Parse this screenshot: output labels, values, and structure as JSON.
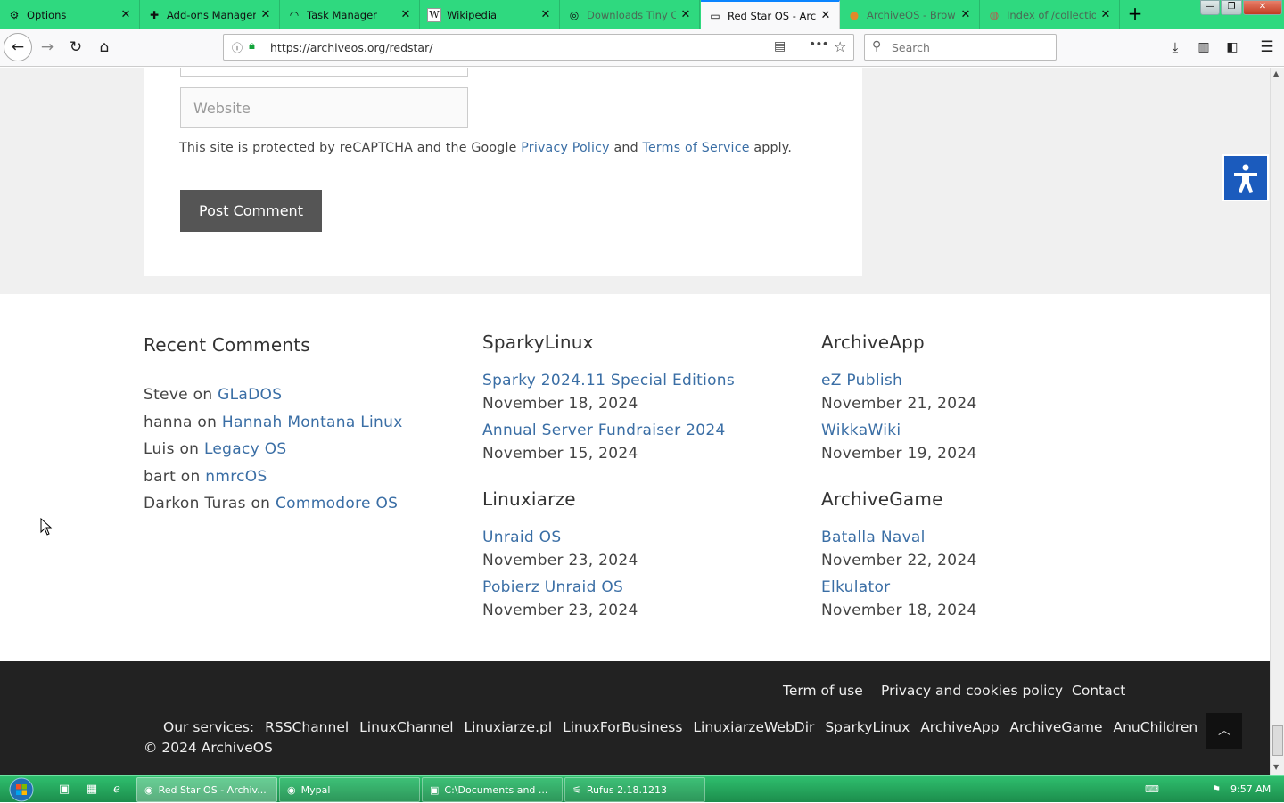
{
  "tabs": [
    {
      "label": "Options",
      "icon": "gear-icon"
    },
    {
      "label": "Add-ons Manager",
      "icon": "puzzle-icon"
    },
    {
      "label": "Task Manager",
      "icon": "gauge-icon"
    },
    {
      "label": "Wikipedia",
      "icon": "wikipedia-icon"
    },
    {
      "label": "Downloads Tiny C",
      "icon": "circle-icon"
    },
    {
      "label": "Red Star OS - Archi",
      "icon": "monitor-icon"
    },
    {
      "label": "ArchiveOS - Brows",
      "icon": "archive-icon"
    },
    {
      "label": "Index of /collectio",
      "icon": "globe-icon"
    }
  ],
  "navbar": {
    "url": "https://archiveos.org/redstar/",
    "search_placeholder": "Search"
  },
  "comment_form": {
    "website_placeholder": "Website",
    "recaptcha_prefix": "This site is protected by reCAPTCHA and the Google",
    "privacy_link": "Privacy Policy",
    "and": "and",
    "terms_link": "Terms of Service",
    "recaptcha_suffix": "apply.",
    "post_button": "Post Comment"
  },
  "recent_comments": {
    "title": "Recent Comments",
    "on": "on",
    "items": [
      {
        "author": "Steve",
        "post": "GLaDOS"
      },
      {
        "author": "hanna",
        "post": "Hannah Montana Linux"
      },
      {
        "author": "Luis",
        "post": "Legacy OS"
      },
      {
        "author": "bart",
        "post": "nmrcOS"
      },
      {
        "author": "Darkon Turas",
        "post": "Commodore OS"
      }
    ]
  },
  "sparkylinux": {
    "title": "SparkyLinux",
    "items": [
      {
        "title": "Sparky 2024.11 Special Editions",
        "date": "November 18, 2024"
      },
      {
        "title": "Annual Server Fundraiser 2024",
        "date": "November 15, 2024"
      }
    ]
  },
  "linuxiarze": {
    "title": "Linuxiarze",
    "items": [
      {
        "title": "Unraid OS",
        "date": "November 23, 2024"
      },
      {
        "title": "Pobierz Unraid OS",
        "date": "November 23, 2024"
      }
    ]
  },
  "archiveapp": {
    "title": "ArchiveApp",
    "items": [
      {
        "title": "eZ Publish",
        "date": "November 21, 2024"
      },
      {
        "title": "WikkaWiki",
        "date": "November 19, 2024"
      }
    ]
  },
  "archivegame": {
    "title": "ArchiveGame",
    "items": [
      {
        "title": "Batalla Naval",
        "date": "November 22, 2024"
      },
      {
        "title": "Elkulator",
        "date": "November 18, 2024"
      }
    ]
  },
  "footer": {
    "links": [
      "Term of use",
      "Privacy and cookies policy",
      "Contact"
    ],
    "services_label": "Our services:",
    "services": [
      "RSSChannel",
      "LinuxChannel",
      "Linuxiarze.pl",
      "LinuxForBusiness",
      "LinuxiarzeWebDir",
      "SparkyLinux",
      "ArchiveApp",
      "ArchiveGame",
      "AnuChildren"
    ],
    "copyright": "© 2024 ArchiveOS"
  },
  "taskbar": {
    "windows": [
      {
        "label": "Red Star OS - Archiv...",
        "icon": "firefox-icon"
      },
      {
        "label": "Mypal",
        "icon": "mypal-icon"
      },
      {
        "label": "C:\\Documents and ...",
        "icon": "7zip-icon"
      },
      {
        "label": "Rufus 2.18.1213",
        "icon": "usb-icon"
      }
    ],
    "clock": "9:57 AM"
  }
}
